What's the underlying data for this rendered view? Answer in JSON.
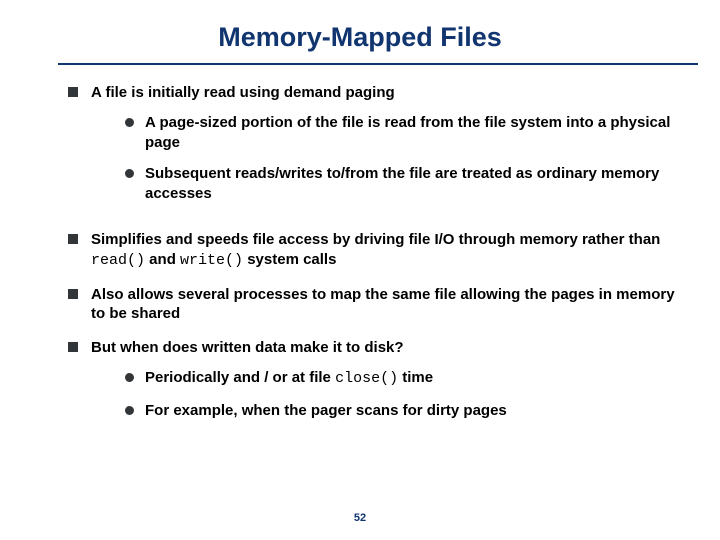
{
  "title": "Memory-Mapped Files",
  "page_number": "52",
  "bullets": {
    "b1_1": "A file is initially read using demand paging",
    "b1_1_s1": "A page-sized portion of the file is read from the file system into a physical page",
    "b1_1_s2": "Subsequent reads/writes to/from the file are treated as ordinary memory accesses",
    "b1_2_pre": "Simplifies and speeds file access by driving file I/O through memory rather than ",
    "b1_2_code1": "read()",
    "b1_2_mid": " and ",
    "b1_2_code2": "write()",
    "b1_2_post": " system calls",
    "b1_3": "Also allows several processes to map the same file allowing the pages in memory to be shared",
    "b1_4": "But when does written data make it to disk?",
    "b1_4_s1_pre": "Periodically and / or at file ",
    "b1_4_s1_code": "close()",
    "b1_4_s1_post": " time",
    "b1_4_s2": "For example, when the pager scans for dirty pages"
  }
}
